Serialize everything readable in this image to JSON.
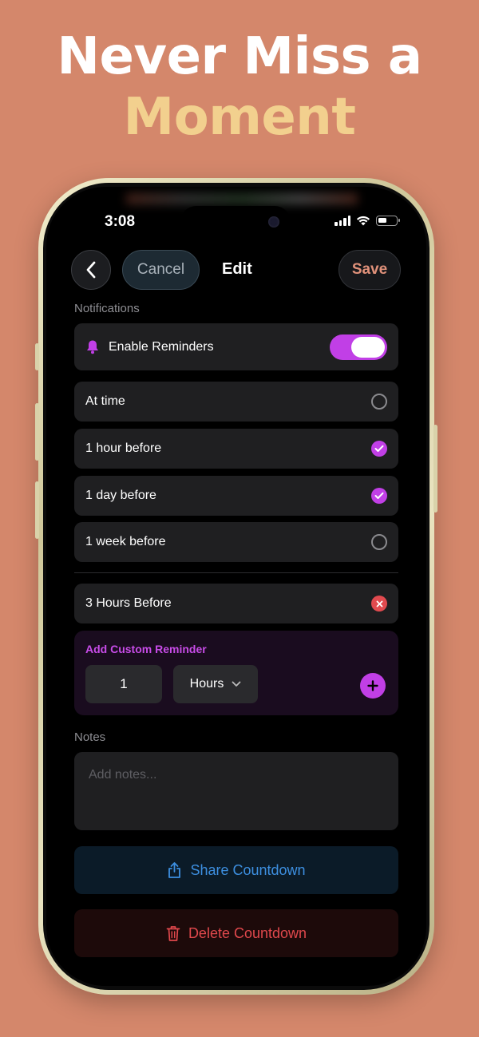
{
  "headline": {
    "line1": "Never Miss a",
    "line2": "Moment"
  },
  "status_bar": {
    "time": "3:08"
  },
  "nav": {
    "cancel_label": "Cancel",
    "title": "Edit",
    "save_label": "Save"
  },
  "notifications": {
    "section_label": "Notifications",
    "enable_reminders_label": "Enable Reminders",
    "enable_reminders_on": true,
    "options": [
      {
        "label": "At time",
        "selected": false
      },
      {
        "label": "1 hour before",
        "selected": true
      },
      {
        "label": "1 day before",
        "selected": true
      },
      {
        "label": "1 week before",
        "selected": false
      }
    ],
    "custom_items": [
      {
        "label": "3 Hours Before"
      }
    ]
  },
  "custom_reminder": {
    "title": "Add Custom Reminder",
    "amount": "1",
    "unit": "Hours"
  },
  "notes": {
    "section_label": "Notes",
    "placeholder": "Add notes..."
  },
  "actions": {
    "share_label": "Share Countdown",
    "delete_label": "Delete Countdown"
  },
  "colors": {
    "accent": "#c13fe6",
    "background": "#d4876b",
    "headline_highlight": "#f2d08e",
    "danger": "#e0484c",
    "share": "#3d8fe0"
  }
}
